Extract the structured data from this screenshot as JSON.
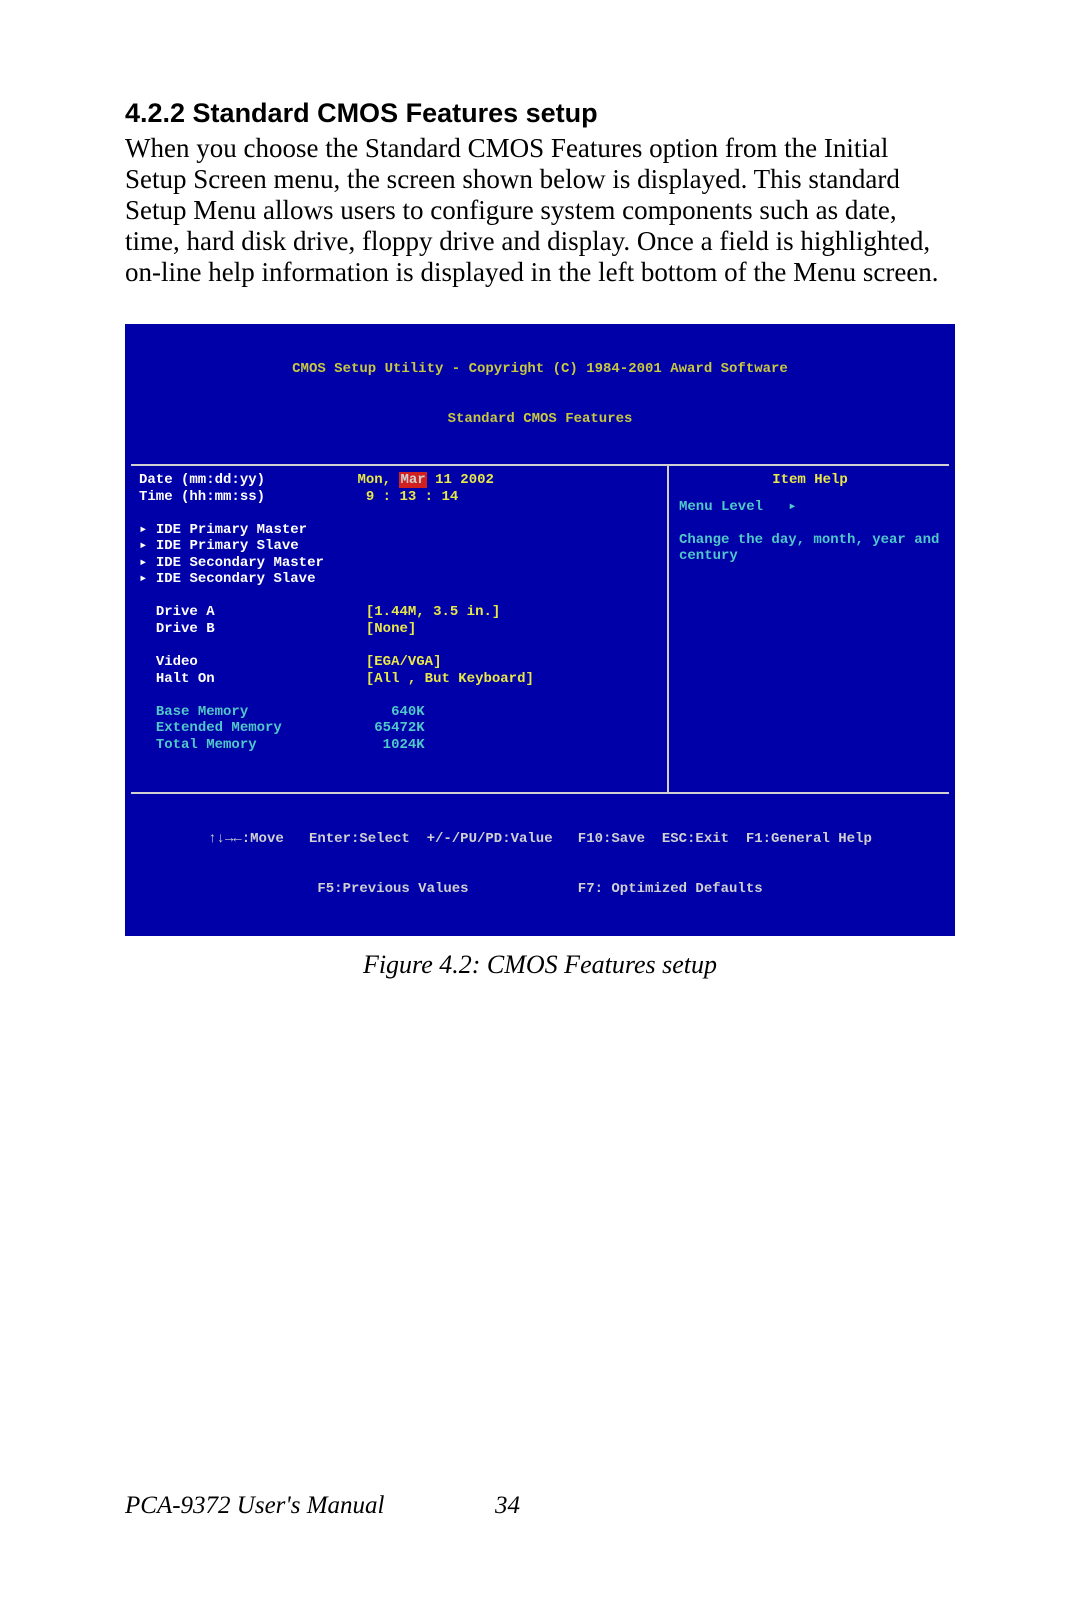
{
  "section": {
    "heading": "4.2.2 Standard CMOS Features setup",
    "body": "When you choose the Standard CMOS Features option from the Initial Setup Screen menu, the screen shown below is displayed. This standard Setup Menu allows users to configure system components such as date, time, hard disk drive, floppy drive and display. Once a field is highlighted, on-line help information is displayed in the left bottom of the Menu screen."
  },
  "bios": {
    "header_line1": "CMOS Setup Utility - Copyright (C) 1984-2001 Award Software",
    "header_line2": "Standard CMOS Features",
    "date_label": "Date (mm:dd:yy)",
    "date_prefix": "Mon, ",
    "date_highlight": "Mar",
    "date_suffix": " 11 2002",
    "time_label": "Time (hh:mm:ss)",
    "time_value": "9 : 13 : 14",
    "ide1": "IDE Primary Master",
    "ide2": "IDE Primary Slave",
    "ide3": "IDE Secondary Master",
    "ide4": "IDE Secondary Slave",
    "driveA_label": "Drive A",
    "driveA_value": "[1.44M, 3.5 in.]",
    "driveB_label": "Drive B",
    "driveB_value": "[None]",
    "video_label": "Video",
    "video_value": "[EGA/VGA]",
    "halt_label": "Halt On",
    "halt_value": "[All , But Keyboard]",
    "base_label": "Base Memory",
    "base_value": "640K",
    "ext_label": "Extended Memory",
    "ext_value": "65472K",
    "total_label": "Total Memory",
    "total_value": "1024K",
    "help_title": "Item Help",
    "menu_level": "Menu Level   ▸",
    "help_text": "Change the day, month, year and century",
    "footer1": "↑↓→←:Move   Enter:Select  +/-/PU/PD:Value   F10:Save  ESC:Exit  F1:General Help",
    "footer2": "F5:Previous Values             F7: Optimized Defaults"
  },
  "caption": "Figure 4.2: CMOS Features setup",
  "footer": {
    "doc": "PCA-9372 User's Manual",
    "page": "34"
  }
}
